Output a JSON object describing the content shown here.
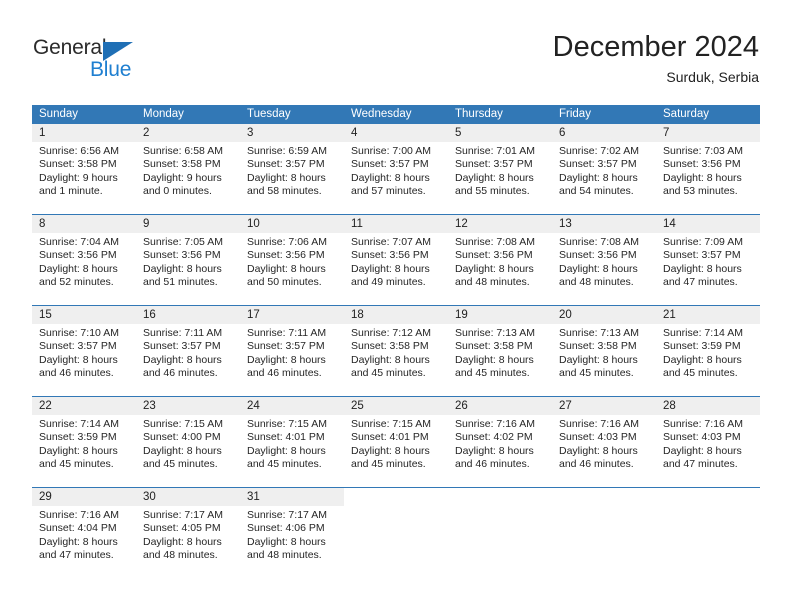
{
  "brand": {
    "name_part1": "General",
    "name_part2": "Blue",
    "accent_color": "#1f7fd0",
    "triangle_color": "#1f6fb5"
  },
  "header": {
    "title": "December 2024",
    "subtitle": "Surduk, Serbia"
  },
  "calendar": {
    "header_bg": "#3278b6",
    "daynum_bg": "#efefef",
    "weekdays": [
      "Sunday",
      "Monday",
      "Tuesday",
      "Wednesday",
      "Thursday",
      "Friday",
      "Saturday"
    ],
    "weeks": [
      [
        {
          "day": "1",
          "sunrise": "Sunrise: 6:56 AM",
          "sunset": "Sunset: 3:58 PM",
          "daylight1": "Daylight: 9 hours",
          "daylight2": "and 1 minute."
        },
        {
          "day": "2",
          "sunrise": "Sunrise: 6:58 AM",
          "sunset": "Sunset: 3:58 PM",
          "daylight1": "Daylight: 9 hours",
          "daylight2": "and 0 minutes."
        },
        {
          "day": "3",
          "sunrise": "Sunrise: 6:59 AM",
          "sunset": "Sunset: 3:57 PM",
          "daylight1": "Daylight: 8 hours",
          "daylight2": "and 58 minutes."
        },
        {
          "day": "4",
          "sunrise": "Sunrise: 7:00 AM",
          "sunset": "Sunset: 3:57 PM",
          "daylight1": "Daylight: 8 hours",
          "daylight2": "and 57 minutes."
        },
        {
          "day": "5",
          "sunrise": "Sunrise: 7:01 AM",
          "sunset": "Sunset: 3:57 PM",
          "daylight1": "Daylight: 8 hours",
          "daylight2": "and 55 minutes."
        },
        {
          "day": "6",
          "sunrise": "Sunrise: 7:02 AM",
          "sunset": "Sunset: 3:57 PM",
          "daylight1": "Daylight: 8 hours",
          "daylight2": "and 54 minutes."
        },
        {
          "day": "7",
          "sunrise": "Sunrise: 7:03 AM",
          "sunset": "Sunset: 3:56 PM",
          "daylight1": "Daylight: 8 hours",
          "daylight2": "and 53 minutes."
        }
      ],
      [
        {
          "day": "8",
          "sunrise": "Sunrise: 7:04 AM",
          "sunset": "Sunset: 3:56 PM",
          "daylight1": "Daylight: 8 hours",
          "daylight2": "and 52 minutes."
        },
        {
          "day": "9",
          "sunrise": "Sunrise: 7:05 AM",
          "sunset": "Sunset: 3:56 PM",
          "daylight1": "Daylight: 8 hours",
          "daylight2": "and 51 minutes."
        },
        {
          "day": "10",
          "sunrise": "Sunrise: 7:06 AM",
          "sunset": "Sunset: 3:56 PM",
          "daylight1": "Daylight: 8 hours",
          "daylight2": "and 50 minutes."
        },
        {
          "day": "11",
          "sunrise": "Sunrise: 7:07 AM",
          "sunset": "Sunset: 3:56 PM",
          "daylight1": "Daylight: 8 hours",
          "daylight2": "and 49 minutes."
        },
        {
          "day": "12",
          "sunrise": "Sunrise: 7:08 AM",
          "sunset": "Sunset: 3:56 PM",
          "daylight1": "Daylight: 8 hours",
          "daylight2": "and 48 minutes."
        },
        {
          "day": "13",
          "sunrise": "Sunrise: 7:08 AM",
          "sunset": "Sunset: 3:56 PM",
          "daylight1": "Daylight: 8 hours",
          "daylight2": "and 48 minutes."
        },
        {
          "day": "14",
          "sunrise": "Sunrise: 7:09 AM",
          "sunset": "Sunset: 3:57 PM",
          "daylight1": "Daylight: 8 hours",
          "daylight2": "and 47 minutes."
        }
      ],
      [
        {
          "day": "15",
          "sunrise": "Sunrise: 7:10 AM",
          "sunset": "Sunset: 3:57 PM",
          "daylight1": "Daylight: 8 hours",
          "daylight2": "and 46 minutes."
        },
        {
          "day": "16",
          "sunrise": "Sunrise: 7:11 AM",
          "sunset": "Sunset: 3:57 PM",
          "daylight1": "Daylight: 8 hours",
          "daylight2": "and 46 minutes."
        },
        {
          "day": "17",
          "sunrise": "Sunrise: 7:11 AM",
          "sunset": "Sunset: 3:57 PM",
          "daylight1": "Daylight: 8 hours",
          "daylight2": "and 46 minutes."
        },
        {
          "day": "18",
          "sunrise": "Sunrise: 7:12 AM",
          "sunset": "Sunset: 3:58 PM",
          "daylight1": "Daylight: 8 hours",
          "daylight2": "and 45 minutes."
        },
        {
          "day": "19",
          "sunrise": "Sunrise: 7:13 AM",
          "sunset": "Sunset: 3:58 PM",
          "daylight1": "Daylight: 8 hours",
          "daylight2": "and 45 minutes."
        },
        {
          "day": "20",
          "sunrise": "Sunrise: 7:13 AM",
          "sunset": "Sunset: 3:58 PM",
          "daylight1": "Daylight: 8 hours",
          "daylight2": "and 45 minutes."
        },
        {
          "day": "21",
          "sunrise": "Sunrise: 7:14 AM",
          "sunset": "Sunset: 3:59 PM",
          "daylight1": "Daylight: 8 hours",
          "daylight2": "and 45 minutes."
        }
      ],
      [
        {
          "day": "22",
          "sunrise": "Sunrise: 7:14 AM",
          "sunset": "Sunset: 3:59 PM",
          "daylight1": "Daylight: 8 hours",
          "daylight2": "and 45 minutes."
        },
        {
          "day": "23",
          "sunrise": "Sunrise: 7:15 AM",
          "sunset": "Sunset: 4:00 PM",
          "daylight1": "Daylight: 8 hours",
          "daylight2": "and 45 minutes."
        },
        {
          "day": "24",
          "sunrise": "Sunrise: 7:15 AM",
          "sunset": "Sunset: 4:01 PM",
          "daylight1": "Daylight: 8 hours",
          "daylight2": "and 45 minutes."
        },
        {
          "day": "25",
          "sunrise": "Sunrise: 7:15 AM",
          "sunset": "Sunset: 4:01 PM",
          "daylight1": "Daylight: 8 hours",
          "daylight2": "and 45 minutes."
        },
        {
          "day": "26",
          "sunrise": "Sunrise: 7:16 AM",
          "sunset": "Sunset: 4:02 PM",
          "daylight1": "Daylight: 8 hours",
          "daylight2": "and 46 minutes."
        },
        {
          "day": "27",
          "sunrise": "Sunrise: 7:16 AM",
          "sunset": "Sunset: 4:03 PM",
          "daylight1": "Daylight: 8 hours",
          "daylight2": "and 46 minutes."
        },
        {
          "day": "28",
          "sunrise": "Sunrise: 7:16 AM",
          "sunset": "Sunset: 4:03 PM",
          "daylight1": "Daylight: 8 hours",
          "daylight2": "and 47 minutes."
        }
      ],
      [
        {
          "day": "29",
          "sunrise": "Sunrise: 7:16 AM",
          "sunset": "Sunset: 4:04 PM",
          "daylight1": "Daylight: 8 hours",
          "daylight2": "and 47 minutes."
        },
        {
          "day": "30",
          "sunrise": "Sunrise: 7:17 AM",
          "sunset": "Sunset: 4:05 PM",
          "daylight1": "Daylight: 8 hours",
          "daylight2": "and 48 minutes."
        },
        {
          "day": "31",
          "sunrise": "Sunrise: 7:17 AM",
          "sunset": "Sunset: 4:06 PM",
          "daylight1": "Daylight: 8 hours",
          "daylight2": "and 48 minutes."
        },
        {
          "day": "",
          "sunrise": "",
          "sunset": "",
          "daylight1": "",
          "daylight2": ""
        },
        {
          "day": "",
          "sunrise": "",
          "sunset": "",
          "daylight1": "",
          "daylight2": ""
        },
        {
          "day": "",
          "sunrise": "",
          "sunset": "",
          "daylight1": "",
          "daylight2": ""
        },
        {
          "day": "",
          "sunrise": "",
          "sunset": "",
          "daylight1": "",
          "daylight2": ""
        }
      ]
    ]
  }
}
